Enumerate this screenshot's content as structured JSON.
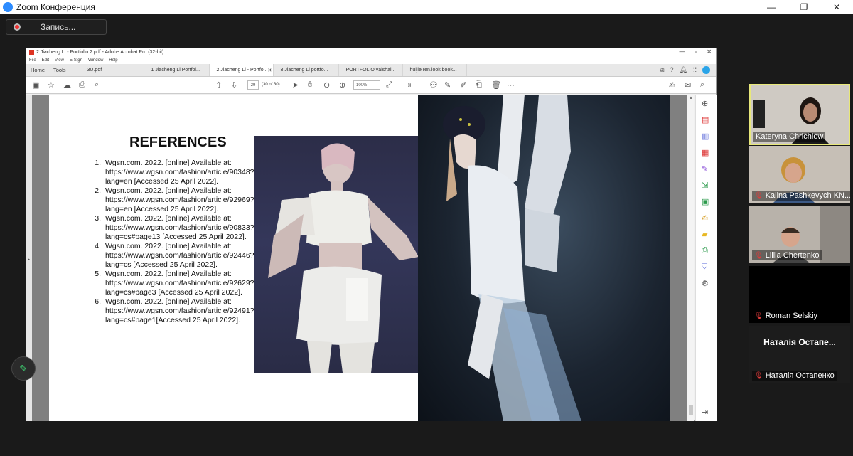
{
  "zoom": {
    "title": "Zoom Конференция",
    "record_label": "Запись...",
    "win_minimize": "—",
    "win_restore": "❐",
    "win_close": "✕"
  },
  "acrobat": {
    "window_title": "2 Jiacheng Li - Portfolio 2.pdf - Adobe Acrobat Pro (32-bit)",
    "menu": [
      "File",
      "Edit",
      "View",
      "E-Sign",
      "Window",
      "Help"
    ],
    "nav_tabs": [
      "Home",
      "Tools"
    ],
    "doc_tabs": [
      "3U.pdf",
      "1 Jiacheng Li Portfol...",
      "2 Jiacheng Li - Portfo...",
      "3 Jiacheng Li portfo...",
      "PORTFOLIO vaishal...",
      "huijie ren.look book..."
    ],
    "active_tab_index": 2,
    "active_tab_close": "✕",
    "page_number": "29",
    "page_of": "(30 of 30)",
    "zoom_level": "100%"
  },
  "document": {
    "title": "REFERENCES",
    "references": [
      {
        "num": "1.",
        "text": "Wgsn.com. 2022. [online] Available at: https://www.wgsn.com/fashion/article/90348?lang=en [Accessed 25 April 2022]."
      },
      {
        "num": "2.",
        "text": "Wgsn.com. 2022. [online] Available at: https://www.wgsn.com/fashion/article/92969?lang=en [Accessed 25 April 2022]."
      },
      {
        "num": "3.",
        "text": "Wgsn.com. 2022. [online] Available at: https://www.wgsn.com/fashion/article/90833?lang=cs#page13 [Accessed 25 April 2022]."
      },
      {
        "num": "4.",
        "text": "Wgsn.com. 2022. [online] Available at: https://www.wgsn.com/fashion/article/92446?lang=cs [Accessed 25 April 2022]."
      },
      {
        "num": "5.",
        "text": "Wgsn.com. 2022. [online] Available at: https://www.wgsn.com/fashion/article/92629?lang=cs#page3 [Accessed 25 April 2022]."
      },
      {
        "num": "6.",
        "text": "Wgsn.com. 2022. [online] Available at: https://www.wgsn.com/fashion/article/92491?lang=cs#page1[Accessed 25 April 2022]."
      }
    ]
  },
  "participants": [
    {
      "name": "Kateryna Chrichlow",
      "muted": false,
      "video": true,
      "active": true
    },
    {
      "name": "Kalina Pashkevych KN...",
      "muted": true,
      "video": true,
      "active": false
    },
    {
      "name": "Liliia Chertenko",
      "muted": true,
      "video": true,
      "active": false
    },
    {
      "name": "Roman Selskiy",
      "muted": true,
      "video": false,
      "active": false
    },
    {
      "name": "Наталія Остапенко",
      "muted": true,
      "video": false,
      "active": false,
      "display_name": "Наталія Остапе..."
    }
  ],
  "colors": {
    "accent": "#2d8cff",
    "active_border": "#e8e87a",
    "muted": "#e03b3b",
    "acrobat_red": "#d32f2f"
  }
}
